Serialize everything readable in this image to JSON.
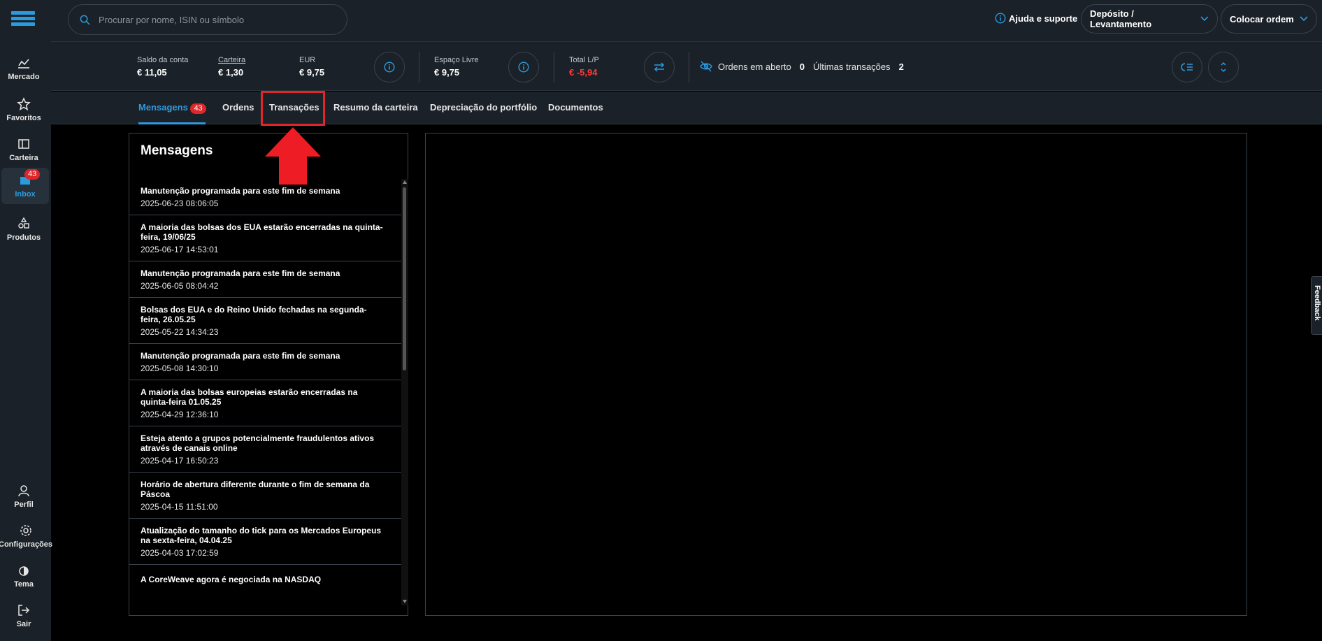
{
  "sidebar": {
    "items": [
      {
        "label": "Mercado"
      },
      {
        "label": "Favoritos"
      },
      {
        "label": "Carteira"
      },
      {
        "label": "Inbox",
        "badge": "43"
      },
      {
        "label": "Produtos"
      }
    ],
    "bottom_items": [
      {
        "label": "Perfil"
      },
      {
        "label": "Configurações"
      },
      {
        "label": "Tema"
      },
      {
        "label": "Sair"
      }
    ]
  },
  "header": {
    "search_placeholder": "Procurar por nome, ISIN ou símbolo",
    "help_label": "Ajuda e suporte",
    "deposit_label": "Depósito / Levantamento",
    "order_label": "Colocar ordem"
  },
  "account": {
    "saldo_label": "Saldo da conta",
    "saldo_value": "€ 11,05",
    "carteira_label": "Carteira",
    "carteira_value": "€ 1,30",
    "eur_label": "EUR",
    "eur_value": "€ 9,75",
    "espaco_label": "Espaço Livre",
    "espaco_value": "€ 9,75",
    "total_label": "Total L/P",
    "total_value": "€ -5,94",
    "open_orders_label": "Ordens em aberto",
    "open_orders_value": "0",
    "last_tx_label": "Últimas transações",
    "last_tx_value": "2"
  },
  "tabs": [
    {
      "label": "Mensagens",
      "badge": "43"
    },
    {
      "label": "Ordens"
    },
    {
      "label": "Transações"
    },
    {
      "label": "Resumo da carteira"
    },
    {
      "label": "Depreciação do portfólio"
    },
    {
      "label": "Documentos"
    }
  ],
  "messages": {
    "title": "Mensagens",
    "items": [
      {
        "title": "Manutenção programada para este fim de semana",
        "date": "2025-06-23 08:06:05"
      },
      {
        "title": "A maioria das bolsas dos EUA estarão encerradas na quinta-feira, 19/06/25",
        "date": "2025-06-17 14:53:01"
      },
      {
        "title": "Manutenção programada para este fim de semana",
        "date": "2025-06-05 08:04:42"
      },
      {
        "title": "Bolsas dos EUA e do Reino Unido fechadas na segunda-feira, 26.05.25",
        "date": "2025-05-22 14:34:23"
      },
      {
        "title": "Manutenção programada para este fim de semana",
        "date": "2025-05-08 14:30:10"
      },
      {
        "title": "A maioria das bolsas europeias estarão encerradas na quinta-feira 01.05.25",
        "date": "2025-04-29 12:36:10"
      },
      {
        "title": "Esteja atento a grupos potencialmente fraudulentos ativos através de canais online",
        "date": "2025-04-17 16:50:23"
      },
      {
        "title": "Horário de abertura diferente durante o fim de semana da Páscoa",
        "date": "2025-04-15 11:51:00"
      },
      {
        "title": "Atualização do tamanho do tick para os Mercados Europeus na sexta-feira, 04.04.25",
        "date": "2025-04-03 17:02:59"
      },
      {
        "title": "A CoreWeave agora é negociada na NASDAQ",
        "date": ""
      }
    ]
  },
  "feedback_label": "Feedback",
  "colors": {
    "accent": "#2b9be0",
    "negative": "#ff3b3b",
    "badge": "#e0262b",
    "panel_bg": "#1b2128"
  }
}
